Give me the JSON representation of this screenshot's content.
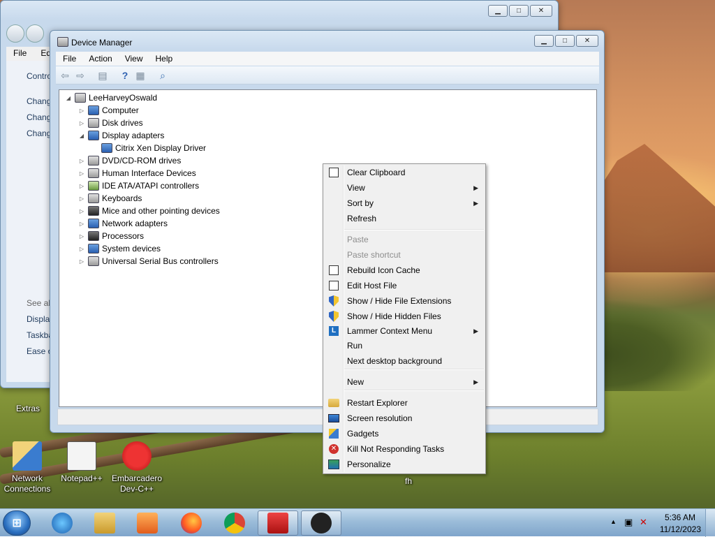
{
  "control_panel": {
    "menu": [
      "File",
      "Edit"
    ],
    "links_top": [
      "Contro",
      "Chang",
      "Chang",
      "Chang"
    ],
    "see_also": "See als",
    "links_bottom": [
      "Display",
      "Taskba",
      "Ease o"
    ]
  },
  "device_manager": {
    "title": "Device Manager",
    "menu": [
      "File",
      "Action",
      "View",
      "Help"
    ],
    "tree": {
      "root": "LeeHarveyOswald",
      "items": [
        {
          "label": "Computer",
          "expanded": false
        },
        {
          "label": "Disk drives",
          "expanded": false
        },
        {
          "label": "Display adapters",
          "expanded": true,
          "children": [
            "Citrix Xen Display Driver"
          ]
        },
        {
          "label": "DVD/CD-ROM drives",
          "expanded": false
        },
        {
          "label": "Human Interface Devices",
          "expanded": false
        },
        {
          "label": "IDE ATA/ATAPI controllers",
          "expanded": false
        },
        {
          "label": "Keyboards",
          "expanded": false
        },
        {
          "label": "Mice and other pointing devices",
          "expanded": false
        },
        {
          "label": "Network adapters",
          "expanded": false
        },
        {
          "label": "Processors",
          "expanded": false
        },
        {
          "label": "System devices",
          "expanded": false
        },
        {
          "label": "Universal Serial Bus controllers",
          "expanded": false
        }
      ]
    }
  },
  "context_menu": {
    "items": [
      {
        "label": "Clear Clipboard",
        "icon": "doc-icon",
        "submenu": false,
        "disabled": false
      },
      {
        "label": "View",
        "icon": "",
        "submenu": true,
        "disabled": false
      },
      {
        "label": "Sort by",
        "icon": "",
        "submenu": true,
        "disabled": false
      },
      {
        "label": "Refresh",
        "icon": "",
        "submenu": false,
        "disabled": false
      },
      {
        "label": "Paste",
        "icon": "",
        "submenu": false,
        "disabled": true
      },
      {
        "label": "Paste shortcut",
        "icon": "",
        "submenu": false,
        "disabled": true
      },
      {
        "label": "Rebuild Icon Cache",
        "icon": "doc-icon",
        "submenu": false,
        "disabled": false
      },
      {
        "label": "Edit Host File",
        "icon": "doc-icon",
        "submenu": false,
        "disabled": false
      },
      {
        "label": "Show / Hide File Extensions",
        "icon": "shield-icon",
        "submenu": false,
        "disabled": false
      },
      {
        "label": "Show / Hide Hidden Files",
        "icon": "shield-icon",
        "submenu": false,
        "disabled": false
      },
      {
        "label": "Lammer Context Menu",
        "icon": "lammer-icon",
        "submenu": true,
        "disabled": false
      },
      {
        "label": "Run",
        "icon": "",
        "submenu": false,
        "disabled": false
      },
      {
        "label": "Next desktop background",
        "icon": "",
        "submenu": false,
        "disabled": false
      },
      {
        "label": "New",
        "icon": "",
        "submenu": true,
        "disabled": false
      },
      {
        "label": "Restart Explorer",
        "icon": "folder-icon",
        "submenu": false,
        "disabled": false
      },
      {
        "label": "Screen resolution",
        "icon": "screen-icon",
        "submenu": false,
        "disabled": false
      },
      {
        "label": "Gadgets",
        "icon": "gadgets-icon",
        "submenu": false,
        "disabled": false
      },
      {
        "label": "Kill Not Responding Tasks",
        "icon": "kill-icon",
        "submenu": false,
        "disabled": false
      },
      {
        "label": "Personalize",
        "icon": "personalize-icon",
        "submenu": false,
        "disabled": false
      }
    ]
  },
  "desktop": {
    "icons": [
      {
        "label": "Extras"
      },
      {
        "label": "Network Connections"
      },
      {
        "label": "Notepad++"
      },
      {
        "label": "Embarcadero Dev-C++"
      },
      {
        "label": "fh"
      }
    ]
  },
  "taskbar": {
    "start_glyph": "⊞",
    "apps": [
      "internet-explorer",
      "file-explorer",
      "media-player",
      "firefox",
      "chrome",
      "toolbox",
      "pinned-app"
    ],
    "time": "5:36 AM",
    "date": "11/12/2023"
  }
}
